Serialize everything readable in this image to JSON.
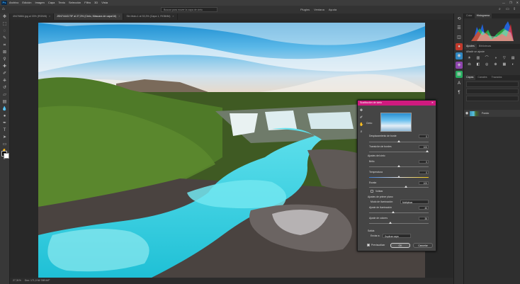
{
  "menubar": {
    "logo": "Ps",
    "items": [
      "Archivo",
      "Edición",
      "Imagen",
      "Capa",
      "Texto",
      "Selección",
      "Filtro",
      "3D",
      "Vista",
      "Plugins",
      "Ventana",
      "Ayuda"
    ],
    "window_controls": [
      "—",
      "❐",
      "✕"
    ]
  },
  "optbar": {
    "search_placeholder": "Buscar para mover la capa de cielo",
    "right_items": [
      "Plugins",
      "Ventana",
      "Ayuda"
    ]
  },
  "tabs": [
    {
      "label": "49476884.jpg al 33% (RGB/8)",
      "active": false
    },
    {
      "label": "JSN74443.TIF al 27,3% (Cielo, Máscara de capa/16)",
      "active": true
    },
    {
      "label": "Sin título-1 al 33,3% (Capa 1, RGB/8#)",
      "active": false
    }
  ],
  "statusbar": {
    "zoom": "27,31%",
    "doc": "Doc: 171,0 M/ 398 M/F"
  },
  "right_panel": {
    "top_tabs": [
      "Color",
      "Histograma"
    ],
    "adj_tabs": [
      "Ajustes",
      "Bibliotecas"
    ],
    "adj_hint": "Añadir un ajuste",
    "layers_tabs": [
      "Capas",
      "Canales",
      "Trazados"
    ],
    "layer_name": "Fondo"
  },
  "dialog": {
    "title": "Sustitución de cielo",
    "close": "✕",
    "sky_label": "Cielo:",
    "rows": [
      {
        "label": "Desplazamiento de borde",
        "value": "0",
        "pos": 0.5
      },
      {
        "label": "Transición de bordes",
        "value": "100",
        "pos": 1.0
      }
    ],
    "section_sky": "Ajustes del cielo",
    "sky_rows": [
      {
        "label": "Brillo",
        "value": "0",
        "pos": 0.5
      },
      {
        "label": "Temperatura",
        "value": "0",
        "pos": 0.5
      },
      {
        "label": "Escala",
        "value": "100",
        "pos": 0.62
      }
    ],
    "flip_label": "Voltear",
    "section_fg": "Ajustes de primer plano",
    "fg_mode_label": "Modo de iluminación:",
    "fg_mode_value": "Multiplicar",
    "fg_rows": [
      {
        "label": "Ajuste de iluminación",
        "value": "40",
        "pos": 0.4
      },
      {
        "label": "Ajuste de colores",
        "value": "35",
        "pos": 0.35
      }
    ],
    "output_label": "Salida",
    "output_to_label": "Enviar a:",
    "output_to_value": "Duplicar capa",
    "preview_label": "Previsualizar",
    "ok_label": "OK",
    "cancel_label": "Cancelar"
  },
  "colors": {
    "accent": "#cf1a7f",
    "panel": "#2f2f2f",
    "bg": "#282828"
  }
}
